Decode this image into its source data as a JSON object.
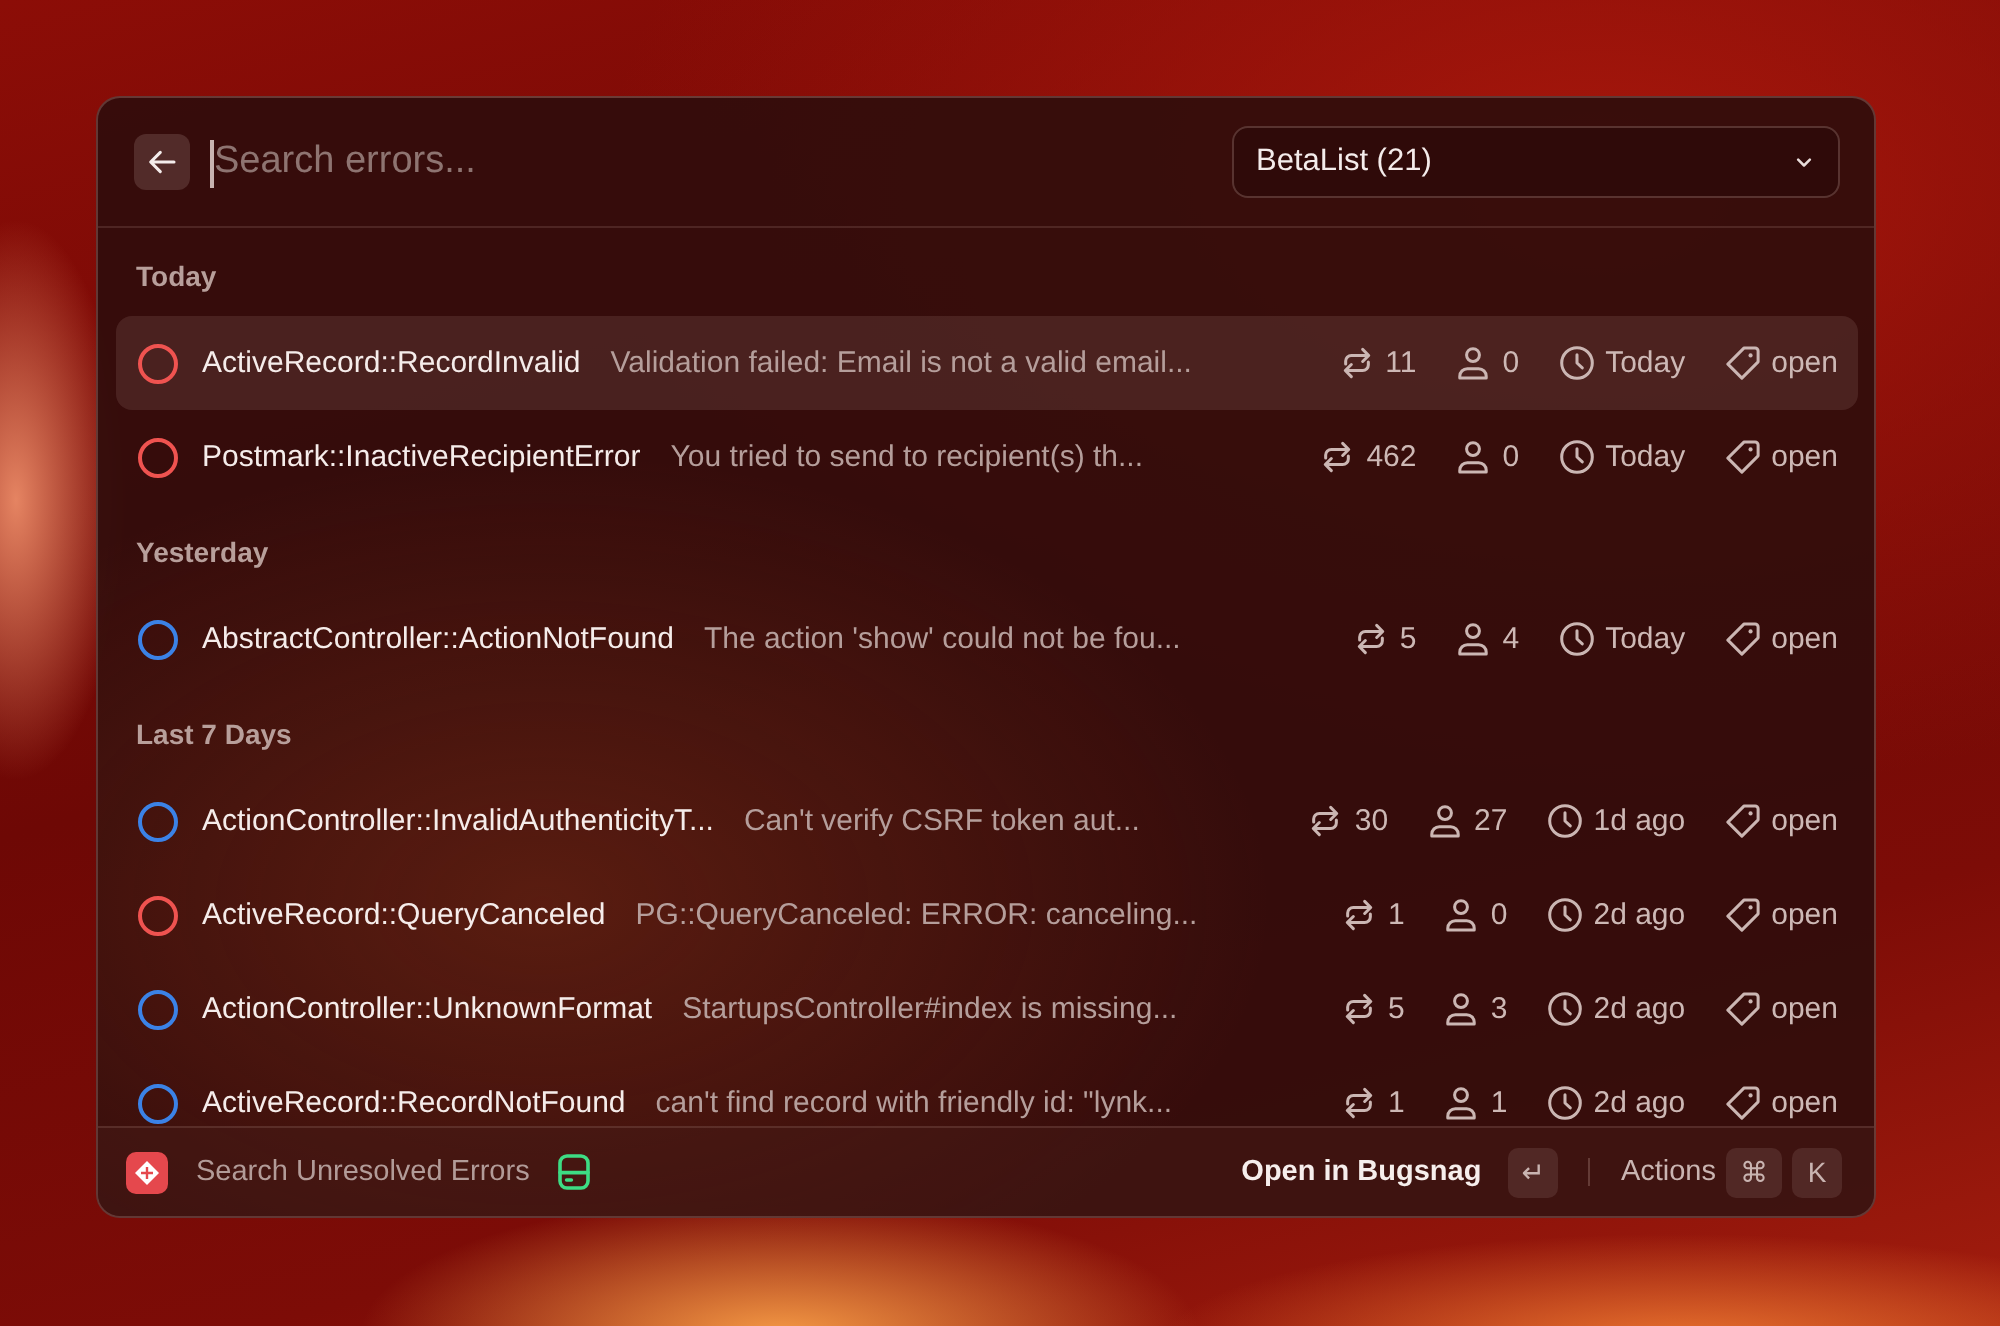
{
  "search": {
    "placeholder": "Search errors...",
    "focused": true
  },
  "project_select": {
    "value": "BetaList (21)"
  },
  "sections": [
    {
      "title": "Today",
      "rows": [
        {
          "name": "ActiveRecord::RecordInvalid",
          "message": "Validation failed: Email is not a valid email...",
          "events": "11",
          "users": "0",
          "last_seen": "Today",
          "status": "open",
          "color": "#ef5350",
          "selected": true
        },
        {
          "name": "Postmark::InactiveRecipientError",
          "message": "You tried to send to recipient(s) th...",
          "events": "462",
          "users": "0",
          "last_seen": "Today",
          "status": "open",
          "color": "#ef5350",
          "selected": false
        }
      ]
    },
    {
      "title": "Yesterday",
      "rows": [
        {
          "name": "AbstractController::ActionNotFound",
          "message": "The action 'show' could not be fou...",
          "events": "5",
          "users": "4",
          "last_seen": "Today",
          "status": "open",
          "color": "#3b82e6",
          "selected": false
        }
      ]
    },
    {
      "title": "Last 7 Days",
      "rows": [
        {
          "name": "ActionController::InvalidAuthenticityT...",
          "message": "Can't verify CSRF token aut...",
          "events": "30",
          "users": "27",
          "last_seen": "1d ago",
          "status": "open",
          "color": "#3b82e6",
          "selected": false
        },
        {
          "name": "ActiveRecord::QueryCanceled",
          "message": "PG::QueryCanceled: ERROR:  canceling...",
          "events": "1",
          "users": "0",
          "last_seen": "2d ago",
          "status": "open",
          "color": "#ef5350",
          "selected": false
        },
        {
          "name": "ActionController::UnknownFormat",
          "message": "StartupsController#index is missing...",
          "events": "5",
          "users": "3",
          "last_seen": "2d ago",
          "status": "open",
          "color": "#3b82e6",
          "selected": false
        },
        {
          "name": "ActiveRecord::RecordNotFound",
          "message": "can't find record with friendly id: \"lynk...",
          "events": "1",
          "users": "1",
          "last_seen": "2d ago",
          "status": "open",
          "color": "#3b82e6",
          "selected": false
        }
      ]
    }
  ],
  "footer": {
    "command": "Search Unresolved Errors",
    "primary_action": "Open in Bugsnag",
    "primary_key": "↵",
    "secondary_action": "Actions",
    "secondary_keys": [
      "⌘",
      "K"
    ]
  }
}
